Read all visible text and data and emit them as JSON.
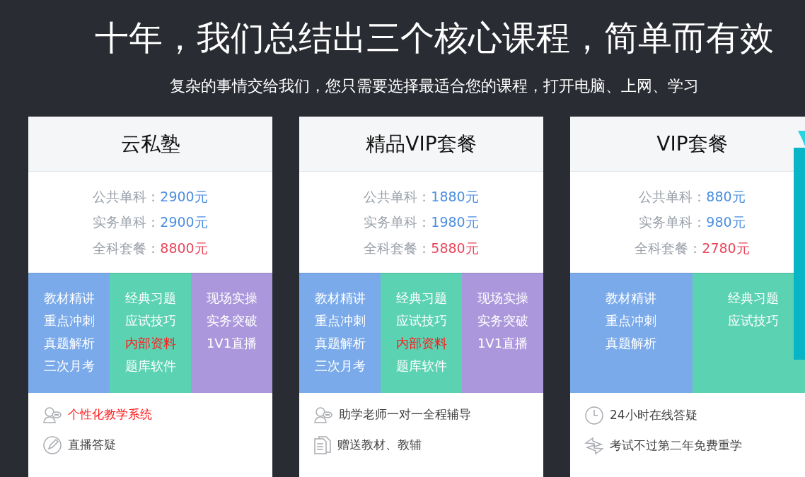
{
  "headline": "十年，我们总结出三个核心课程，简单而有效",
  "subheadline": "复杂的事情交给我们，您只需要选择最适合您的课程，打开电脑、上网、学习",
  "cards": [
    {
      "title": "云私塾",
      "prices": [
        {
          "label": "公共单科：",
          "value": "2900元",
          "highlight": false
        },
        {
          "label": "实务单科：",
          "value": "2900元",
          "highlight": false
        },
        {
          "label": "全科套餐：",
          "value": "8800元",
          "highlight": true
        }
      ],
      "features": [
        {
          "color": "#7aaaea",
          "items": [
            {
              "text": "教材精讲",
              "highlight": false
            },
            {
              "text": "重点冲刺",
              "highlight": false
            },
            {
              "text": "真题解析",
              "highlight": false
            },
            {
              "text": "三次月考",
              "highlight": false
            }
          ]
        },
        {
          "color": "#5bd2b2",
          "items": [
            {
              "text": "经典习题",
              "highlight": false
            },
            {
              "text": "应试技巧",
              "highlight": false
            },
            {
              "text": "内部资料",
              "highlight": true
            },
            {
              "text": "题库软件",
              "highlight": false
            }
          ]
        },
        {
          "color": "#ab97db",
          "items": [
            {
              "text": "现场实操",
              "highlight": false
            },
            {
              "text": "实务突破",
              "highlight": false
            },
            {
              "text": "1V1直播",
              "highlight": false
            }
          ]
        }
      ],
      "perks": [
        {
          "kind": "chat",
          "text": "个性化教学系统",
          "highlight": true
        },
        {
          "kind": "pencil",
          "text": "直播答疑",
          "highlight": false
        }
      ]
    },
    {
      "title": "精品VIP套餐",
      "prices": [
        {
          "label": "公共单科：",
          "value": "1880元",
          "highlight": false
        },
        {
          "label": "实务单科：",
          "value": "1980元",
          "highlight": false
        },
        {
          "label": "全科套餐：",
          "value": "5880元",
          "highlight": true
        }
      ],
      "features": [
        {
          "color": "#7aaaea",
          "items": [
            {
              "text": "教材精讲",
              "highlight": false
            },
            {
              "text": "重点冲刺",
              "highlight": false
            },
            {
              "text": "真题解析",
              "highlight": false
            },
            {
              "text": "三次月考",
              "highlight": false
            }
          ]
        },
        {
          "color": "#5bd2b2",
          "items": [
            {
              "text": "经典习题",
              "highlight": false
            },
            {
              "text": "应试技巧",
              "highlight": false
            },
            {
              "text": "内部资料",
              "highlight": true
            },
            {
              "text": "题库软件",
              "highlight": false
            }
          ]
        },
        {
          "color": "#ab97db",
          "items": [
            {
              "text": "现场实操",
              "highlight": false
            },
            {
              "text": "实务突破",
              "highlight": false
            },
            {
              "text": "1V1直播",
              "highlight": false
            }
          ]
        }
      ],
      "perks": [
        {
          "kind": "chat",
          "text": "助学老师一对一全程辅导",
          "highlight": false
        },
        {
          "kind": "document",
          "text": "赠送教材、教辅",
          "highlight": false
        }
      ]
    },
    {
      "title": "VIP套餐",
      "prices": [
        {
          "label": "公共单科：",
          "value": "880元",
          "highlight": false
        },
        {
          "label": "实务单科：",
          "value": "980元",
          "highlight": false
        },
        {
          "label": "全科套餐：",
          "value": "2780元",
          "highlight": true
        }
      ],
      "features": [
        {
          "color": "#7aaaea",
          "items": [
            {
              "text": "教材精讲",
              "highlight": false
            },
            {
              "text": "重点冲刺",
              "highlight": false
            },
            {
              "text": "真题解析",
              "highlight": false
            }
          ]
        },
        {
          "color": "#5bd2b2",
          "items": [
            {
              "text": "经典习题",
              "highlight": false
            },
            {
              "text": "应试技巧",
              "highlight": false
            }
          ]
        }
      ],
      "perks": [
        {
          "kind": "clock",
          "text": "24小时在线答疑",
          "highlight": false
        },
        {
          "kind": "exchange",
          "text": "考试不过第二年免费重学",
          "highlight": false
        }
      ]
    }
  ]
}
